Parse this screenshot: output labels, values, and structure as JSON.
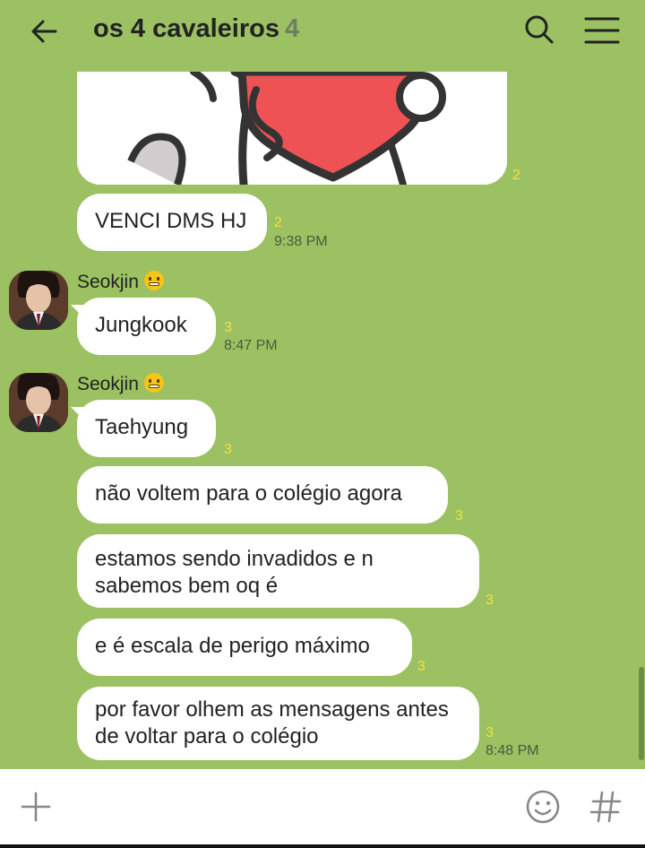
{
  "header": {
    "title": "os 4 cavaleiros",
    "member_count": "4",
    "back_icon": "arrow-left-icon",
    "search_icon": "search-icon",
    "menu_icon": "hamburger-menu-icon"
  },
  "messages": {
    "sticker": {
      "read": "2"
    },
    "m1": {
      "text": "VENCI DMS HJ",
      "read": "2",
      "time": "9:38 PM"
    },
    "g1": {
      "sender": "Seokjin",
      "m1": {
        "text": "Jungkook",
        "read": "3",
        "time": "8:47 PM"
      }
    },
    "g2": {
      "sender": "Seokjin",
      "m1": {
        "text": "Taehyung",
        "read": "3"
      },
      "m2": {
        "text": "não voltem para o colégio agora",
        "read": "3"
      },
      "m3": {
        "text": "estamos sendo invadidos e n sabemos bem oq é",
        "read": "3"
      },
      "m4": {
        "text": "e é escala de perigo máximo",
        "read": "3"
      },
      "m5": {
        "text": "por favor olhem as mensagens antes de voltar para o colégio",
        "read": "3",
        "time": "8:48 PM"
      }
    }
  },
  "composer": {
    "add_icon": "plus-icon",
    "emoji_icon": "smiley-icon",
    "hashtag_glyph": "#"
  },
  "colors": {
    "background": "#9bc162",
    "bubble": "#ffffff",
    "read_count": "#f3e23a"
  }
}
